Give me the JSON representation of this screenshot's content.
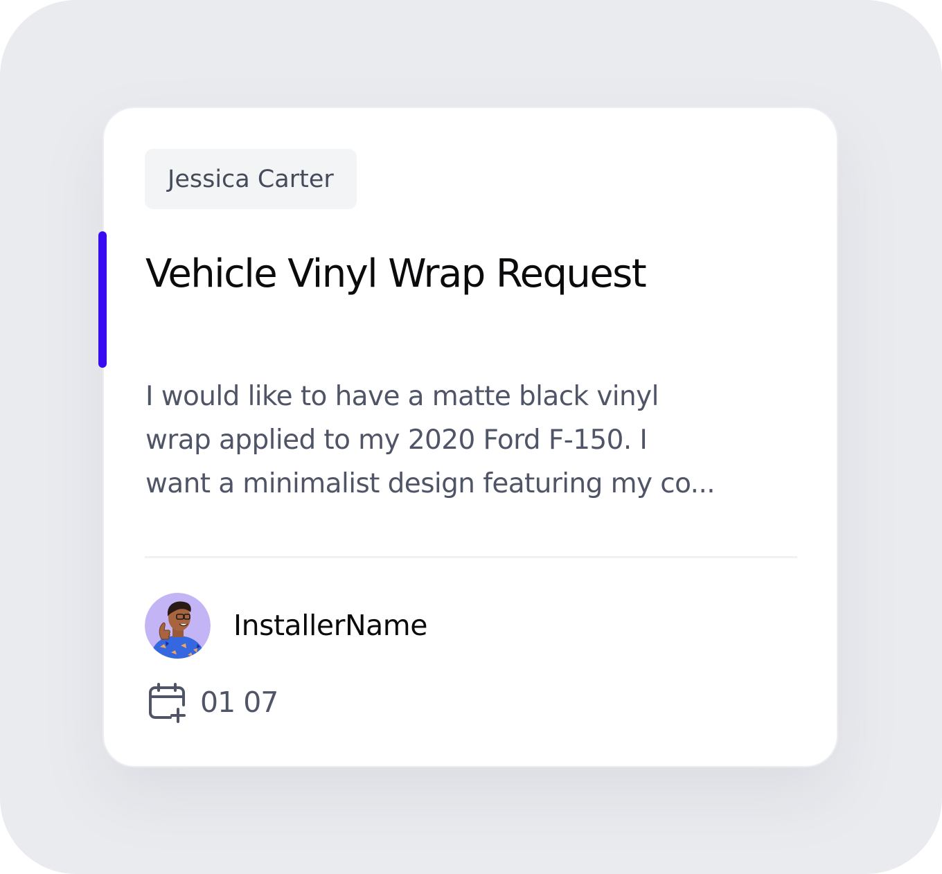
{
  "card": {
    "customer_name": "Jessica Carter",
    "title": "Vehicle Vinyl Wrap Request",
    "description_lines": [
      "I would like to have a matte black vinyl",
      "wrap applied to my 2020 Ford F-150. I",
      "want a minimalist design featuring my co..."
    ],
    "installer": {
      "name": "InstallerName",
      "avatar_icon": "avatar-illustration"
    },
    "date": {
      "icon": "calendar-plus-icon",
      "value": "01 07"
    },
    "colors": {
      "accent": "#3a0af0",
      "avatar_bg": "#c3b4f5"
    }
  }
}
